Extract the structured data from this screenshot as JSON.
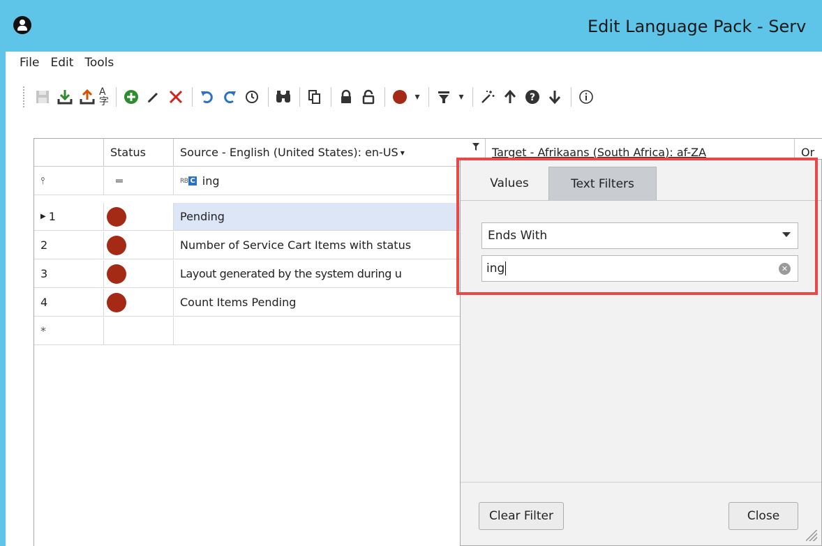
{
  "window": {
    "title": "Edit Language Pack - Serv"
  },
  "menu": {
    "items": [
      "File",
      "Edit",
      "Tools"
    ]
  },
  "toolbar": {
    "icons": [
      "save-icon",
      "import-icon",
      "export-icon",
      "translate-icon",
      "add-icon",
      "edit-icon",
      "delete-icon",
      "undo-icon",
      "redo-icon",
      "history-icon",
      "find-icon",
      "copy-icon",
      "lock-icon",
      "unlock-icon",
      "status-icon",
      "filter-icon",
      "wand-icon",
      "up-arrow-icon",
      "help-icon",
      "down-arrow-icon",
      "info-icon"
    ]
  },
  "colors": {
    "titlebar": "#5ec4e8",
    "status_dot": "#a52a16",
    "highlight": "#e84848",
    "accent": "#2b72c6"
  },
  "grid": {
    "columns": [
      "",
      "Status",
      "Source - English (United States): en-US",
      "Target - Afrikaans (South Africa): af-ZA",
      "Or"
    ],
    "filter_row": {
      "status_op": "═",
      "source_filter": "ing"
    },
    "rows": [
      {
        "num": "1",
        "source": "Pending"
      },
      {
        "num": "2",
        "source": "Number of Service Cart Items with status"
      },
      {
        "num": "3",
        "source": "Layout generated by the system during u"
      },
      {
        "num": "4",
        "source": "Count Items Pending"
      }
    ],
    "new_row_marker": "*"
  },
  "filter_popup": {
    "tabs": [
      "Values",
      "Text Filters"
    ],
    "active_tab": "Text Filters",
    "condition": "Ends With",
    "value": "ing",
    "clear_button": "Clear Filter",
    "close_button": "Close"
  }
}
